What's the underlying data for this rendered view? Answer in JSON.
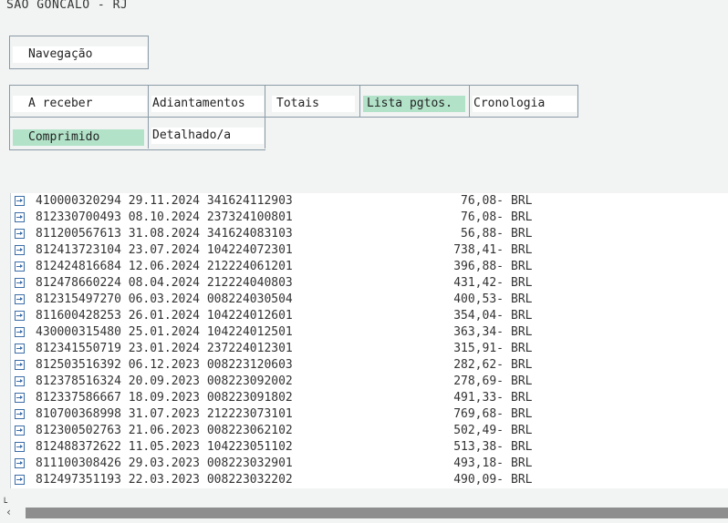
{
  "window": {
    "title": "SAO GONCALO - RJ"
  },
  "nav": {
    "label": "Navegação"
  },
  "tabs": [
    {
      "label": "A receber",
      "selected": false
    },
    {
      "label": "Adiantamentos",
      "selected": false
    },
    {
      "label": "Totais",
      "selected": false
    },
    {
      "label": "Lista pgtos.",
      "selected": true
    },
    {
      "label": "Cronologia",
      "selected": false
    }
  ],
  "view_modes": [
    {
      "label": "Comprimido",
      "selected": true
    },
    {
      "label": "Detalhado/a",
      "selected": false
    }
  ],
  "payments": [
    {
      "text": "410000320294 29.11.2024 341624112903",
      "amount": "76,08-",
      "currency": "BRL"
    },
    {
      "text": "812330700493 08.10.2024 237324100801",
      "amount": "76,08-",
      "currency": "BRL"
    },
    {
      "text": "811200567613 31.08.2024 341624083103",
      "amount": "56,88-",
      "currency": "BRL"
    },
    {
      "text": "812413723104 23.07.2024 104224072301",
      "amount": "738,41-",
      "currency": "BRL"
    },
    {
      "text": "812424816684 12.06.2024 212224061201",
      "amount": "396,88-",
      "currency": "BRL"
    },
    {
      "text": "812478660224 08.04.2024 212224040803",
      "amount": "431,42-",
      "currency": "BRL"
    },
    {
      "text": "812315497270 06.03.2024 008224030504",
      "amount": "400,53-",
      "currency": "BRL"
    },
    {
      "text": "811600428253 26.01.2024 104224012601",
      "amount": "354,04-",
      "currency": "BRL"
    },
    {
      "text": "430000315480 25.01.2024 104224012501",
      "amount": "363,34-",
      "currency": "BRL"
    },
    {
      "text": "812341550719 23.01.2024 237224012301",
      "amount": "315,91-",
      "currency": "BRL"
    },
    {
      "text": "812503516392 06.12.2023 008223120603",
      "amount": "282,62-",
      "currency": "BRL"
    },
    {
      "text": "812378516324 20.09.2023 008223092002",
      "amount": "278,69-",
      "currency": "BRL"
    },
    {
      "text": "812337586667 18.09.2023 008223091802",
      "amount": "491,33-",
      "currency": "BRL"
    },
    {
      "text": "810700368998 31.07.2023 212223073101",
      "amount": "769,68-",
      "currency": "BRL"
    },
    {
      "text": "812300502763 21.06.2023 008223062102",
      "amount": "502,49-",
      "currency": "BRL"
    },
    {
      "text": "812488372622 11.05.2023 104223051102",
      "amount": "513,38-",
      "currency": "BRL"
    },
    {
      "text": "811100308426 29.03.2023 008223032901",
      "amount": "493,18-",
      "currency": "BRL"
    },
    {
      "text": "812497351193 22.03.2023 008223032202",
      "amount": "490,09-",
      "currency": "BRL"
    }
  ],
  "icons": {
    "row": "expand-node-icon",
    "scroll": "scroll-arrows-icon"
  }
}
